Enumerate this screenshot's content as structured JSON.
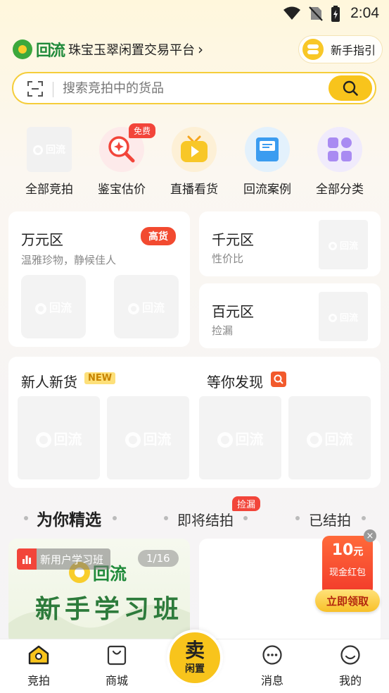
{
  "status_bar": {
    "time": "2:04"
  },
  "header": {
    "brand_mark": "回流",
    "platform_name": "珠宝玉翠闲置交易平台",
    "chevron": "›",
    "guide_label": "新手指引"
  },
  "search": {
    "placeholder": "搜索竞拍中的货品"
  },
  "categories": [
    {
      "label": "全部竞拍",
      "icon": "image-placeholder-icon"
    },
    {
      "label": "鉴宝估价",
      "icon": "magnifier-icon",
      "badge": "免费"
    },
    {
      "label": "直播看货",
      "icon": "tv-play-icon"
    },
    {
      "label": "回流案例",
      "icon": "case-folder-icon"
    },
    {
      "label": "全部分类",
      "icon": "grid-categories-icon"
    }
  ],
  "zones": {
    "wan": {
      "title": "万元区",
      "subtitle": "温雅珍物，静候佳人",
      "badge": "高货"
    },
    "qian": {
      "title": "千元区",
      "subtitle": "性价比"
    },
    "bai": {
      "title": "百元区",
      "subtitle": "捡漏"
    },
    "new_goods": {
      "title": "新人新货",
      "badge": "NEW"
    },
    "discover": {
      "title": "等你发现"
    }
  },
  "placeholder_mark": "回流",
  "tabs": [
    {
      "label": "为你精选",
      "active": true
    },
    {
      "label": "即将结拍",
      "badge": "捡漏"
    },
    {
      "label": "已结拍"
    }
  ],
  "featured": {
    "tag": "新用户学习班",
    "page": "1/16",
    "banner_mark": "回流",
    "title": "新手学习班"
  },
  "red_packet": {
    "amount": "10",
    "unit": "元",
    "desc": "现金红包",
    "button": "立即领取",
    "close": "×"
  },
  "bottom_nav": {
    "items": [
      {
        "label": "竞拍",
        "icon": "home-icon"
      },
      {
        "label": "商城",
        "icon": "shopping-bag-icon"
      },
      {
        "label": "消息",
        "icon": "chat-bubble-icon"
      },
      {
        "label": "我的",
        "icon": "smiley-profile-icon"
      }
    ],
    "sell_main": "卖",
    "sell_sub": "闲置"
  },
  "colors": {
    "accent": "#f8c41c",
    "hot": "#f24a30",
    "brand_green": "#3ca83c"
  }
}
